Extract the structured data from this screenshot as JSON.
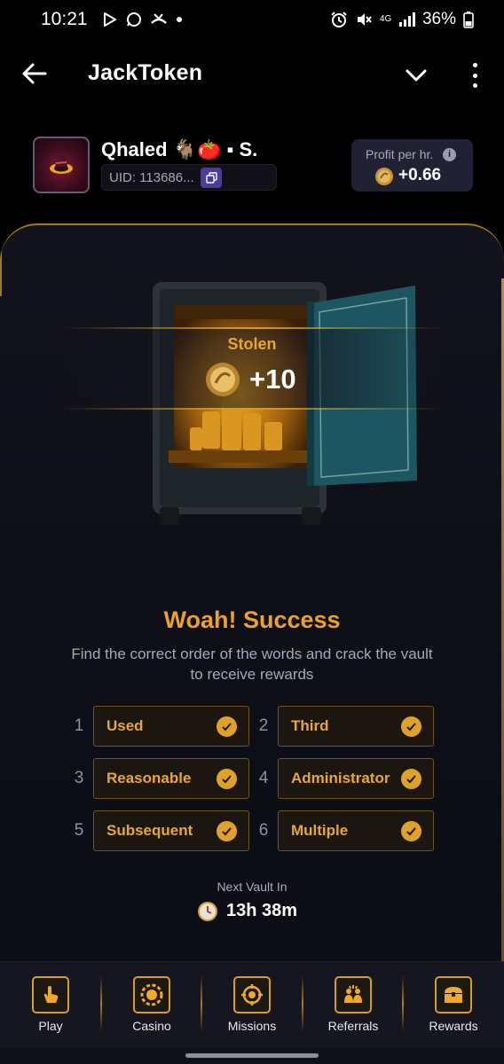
{
  "status_bar": {
    "time": "10:21",
    "network": "4G",
    "battery": "36%",
    "left_icons": [
      "play-store-icon",
      "whatsapp-icon",
      "missed-call-icon",
      "dot-icon"
    ],
    "right_icons": [
      "alarm-icon",
      "mute-icon",
      "signal-icon",
      "battery-icon"
    ]
  },
  "app_bar": {
    "title": "JackToken",
    "icons": [
      "back-arrow-icon",
      "chevron-down-icon",
      "kebab-menu-icon"
    ]
  },
  "profile": {
    "name": "Qhaled 🐐🍅 ▪ S.",
    "uid": "UID: 113686...",
    "profit_label": "Profit per hr.",
    "profit_value": "+0.66"
  },
  "vault": {
    "stolen_label": "Stolen",
    "stolen_amount": "+10",
    "headline": "Woah! Success",
    "description": "Find the correct order of the words and crack the vault to receive rewards",
    "words": [
      {
        "num": "1",
        "word": "Used",
        "solved": true
      },
      {
        "num": "2",
        "word": "Third",
        "solved": true
      },
      {
        "num": "3",
        "word": "Reasonable",
        "solved": true
      },
      {
        "num": "4",
        "word": "Administrator",
        "solved": true
      },
      {
        "num": "5",
        "word": "Subsequent",
        "solved": true
      },
      {
        "num": "6",
        "word": "Multiple",
        "solved": true
      }
    ],
    "next_label": "Next Vault In",
    "timer": "13h 38m"
  },
  "bottom_nav": [
    {
      "label": "Play",
      "icon": "tap-hand-icon"
    },
    {
      "label": "Casino",
      "icon": "casino-chip-icon"
    },
    {
      "label": "Missions",
      "icon": "target-icon"
    },
    {
      "label": "Referrals",
      "icon": "people-icon"
    },
    {
      "label": "Rewards",
      "icon": "treasure-chest-icon"
    }
  ],
  "colors": {
    "accent": "#eda12a",
    "background": "#0d0e16",
    "chip_border": "#6f5522",
    "nav_background": "#15161f"
  }
}
